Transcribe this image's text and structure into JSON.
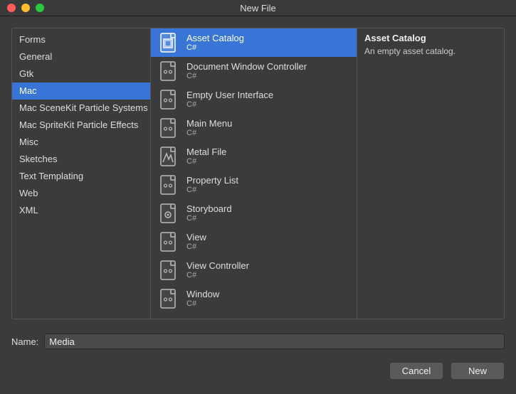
{
  "window": {
    "title": "New File"
  },
  "categories": [
    {
      "label": "Forms",
      "selected": false
    },
    {
      "label": "General",
      "selected": false
    },
    {
      "label": "Gtk",
      "selected": false
    },
    {
      "label": "Mac",
      "selected": true
    },
    {
      "label": "Mac SceneKit Particle Systems",
      "selected": false
    },
    {
      "label": "Mac SpriteKit Particle Effects",
      "selected": false
    },
    {
      "label": "Misc",
      "selected": false
    },
    {
      "label": "Sketches",
      "selected": false
    },
    {
      "label": "Text Templating",
      "selected": false
    },
    {
      "label": "Web",
      "selected": false
    },
    {
      "label": "XML",
      "selected": false
    }
  ],
  "templates": [
    {
      "title": "Asset Catalog",
      "subtitle": "C#",
      "icon": "asset-catalog",
      "selected": true
    },
    {
      "title": "Document Window Controller",
      "subtitle": "C#",
      "icon": "file",
      "selected": false
    },
    {
      "title": "Empty User Interface",
      "subtitle": "C#",
      "icon": "file",
      "selected": false
    },
    {
      "title": "Main Menu",
      "subtitle": "C#",
      "icon": "file",
      "selected": false
    },
    {
      "title": "Metal File",
      "subtitle": "C#",
      "icon": "metal",
      "selected": false
    },
    {
      "title": "Property List",
      "subtitle": "C#",
      "icon": "file",
      "selected": false
    },
    {
      "title": "Storyboard",
      "subtitle": "C#",
      "icon": "storyboard",
      "selected": false
    },
    {
      "title": "View",
      "subtitle": "C#",
      "icon": "file",
      "selected": false
    },
    {
      "title": "View Controller",
      "subtitle": "C#",
      "icon": "file",
      "selected": false
    },
    {
      "title": "Window",
      "subtitle": "C#",
      "icon": "file",
      "selected": false
    }
  ],
  "detail": {
    "title": "Asset Catalog",
    "description": "An empty asset catalog."
  },
  "name": {
    "label": "Name:",
    "value": "Media"
  },
  "buttons": {
    "cancel": "Cancel",
    "new": "New"
  },
  "icons": {
    "file": "file-icon",
    "metal": "metal-file-icon",
    "storyboard": "storyboard-icon",
    "asset-catalog": "asset-catalog-icon"
  }
}
